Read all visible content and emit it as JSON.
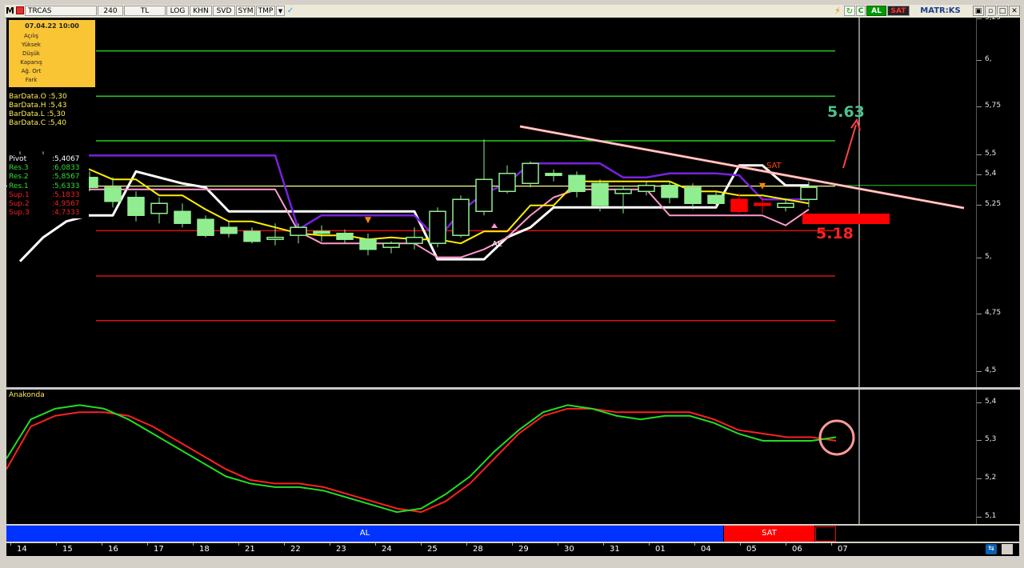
{
  "toolbar": {
    "m_label": "M",
    "symbol": "TRCAS",
    "period": "240",
    "currency": "TL",
    "buttons": [
      "LOG",
      "KHN",
      "SVD",
      "SYM",
      "TMP"
    ],
    "signal_al": "AL",
    "signal_sat": "SAT",
    "brand": "MATR:KS"
  },
  "info_box": {
    "date": "07.04.22 10:00",
    "fields": [
      "Açılış",
      "Yüksek",
      "Düşük",
      "Kapanış",
      "Ağ. Ort",
      "Fark"
    ]
  },
  "bar_data": [
    "BarData.O :5,30",
    "BarData.H :5,43",
    "BarData.L :5,30",
    "BarData.C :5,40"
  ],
  "pivot": {
    "rows": [
      {
        "key": "Pivot",
        "value": ":5,4067",
        "color": "#ffffff"
      },
      {
        "key": "Res.3",
        "value": ":6,0833",
        "color": "#33dd33"
      },
      {
        "key": "Res.2",
        "value": ":5,8567",
        "color": "#33dd33"
      },
      {
        "key": "Res.1",
        "value": ":5,6333",
        "color": "#33dd33"
      },
      {
        "key": "Sup.1",
        "value": ":5,1833",
        "color": "#ee2222"
      },
      {
        "key": "Sup.2",
        "value": ":4,9567",
        "color": "#ee2222"
      },
      {
        "key": "Sup.3",
        "value": ":4,7333",
        "color": "#ee2222"
      }
    ]
  },
  "annotations": {
    "target_high": "5.63",
    "target_low": "5.18",
    "al_label": "AL",
    "sat_label": "SAT"
  },
  "y_axis_main": [
    "5,25",
    "6,",
    "5,75",
    "5,5",
    "5,4",
    "5,25",
    "5,",
    "4,75",
    "4,5"
  ],
  "y_axis_sub": [
    "5,4",
    "5,3",
    "5,2",
    "5,1"
  ],
  "indicator_title": "Anakonda",
  "signal_bar": {
    "al": "AL",
    "sat": "SAT"
  },
  "dates": [
    "14",
    "15",
    "16",
    "17",
    "18",
    "21",
    "22",
    "23",
    "24",
    "25",
    "28",
    "29",
    "30",
    "31",
    "01",
    "04",
    "05",
    "06",
    "07"
  ],
  "colors": {
    "bull": "#90ee90",
    "bear": "#ff0000",
    "resistance": "#22cc22",
    "support": "#dd1111",
    "pivot": "#ffff88",
    "purple": "#7722dd",
    "white": "#ffffff",
    "yellow": "#ffee00",
    "pink": "#ff99cc",
    "al_bar": "#0033ff",
    "sat_bar": "#ff0000"
  },
  "chart_data": {
    "type": "candlestick",
    "ylim": [
      4.4,
      6.25
    ],
    "candles": [
      {
        "o": 5.5,
        "h": 5.58,
        "l": 5.48,
        "c": 5.55
      },
      {
        "o": 5.55,
        "h": 5.58,
        "l": 5.5,
        "c": 5.53
      },
      {
        "o": 5.48,
        "h": 5.52,
        "l": 5.4,
        "c": 5.45
      },
      {
        "o": 5.45,
        "h": 5.48,
        "l": 5.38,
        "c": 5.4
      },
      {
        "o": 5.4,
        "h": 5.45,
        "l": 5.3,
        "c": 5.33
      },
      {
        "o": 5.35,
        "h": 5.38,
        "l": 5.23,
        "c": 5.26
      },
      {
        "o": 5.27,
        "h": 5.35,
        "l": 5.22,
        "c": 5.32
      },
      {
        "o": 5.28,
        "h": 5.32,
        "l": 5.2,
        "c": 5.22
      },
      {
        "o": 5.24,
        "h": 5.26,
        "l": 5.15,
        "c": 5.16
      },
      {
        "o": 5.2,
        "h": 5.23,
        "l": 5.15,
        "c": 5.17
      },
      {
        "o": 5.18,
        "h": 5.2,
        "l": 5.12,
        "c": 5.13
      },
      {
        "o": 5.14,
        "h": 5.22,
        "l": 5.11,
        "c": 5.15
      },
      {
        "o": 5.16,
        "h": 5.22,
        "l": 5.12,
        "c": 5.2
      },
      {
        "o": 5.18,
        "h": 5.21,
        "l": 5.13,
        "c": 5.17
      },
      {
        "o": 5.17,
        "h": 5.19,
        "l": 5.12,
        "c": 5.14
      },
      {
        "o": 5.14,
        "h": 5.17,
        "l": 5.06,
        "c": 5.09
      },
      {
        "o": 5.1,
        "h": 5.13,
        "l": 5.07,
        "c": 5.12
      },
      {
        "o": 5.12,
        "h": 5.2,
        "l": 5.09,
        "c": 5.15
      },
      {
        "o": 5.12,
        "h": 5.3,
        "l": 5.1,
        "c": 5.28
      },
      {
        "o": 5.16,
        "h": 5.36,
        "l": 5.15,
        "c": 5.34
      },
      {
        "o": 5.28,
        "h": 5.64,
        "l": 5.26,
        "c": 5.44
      },
      {
        "o": 5.38,
        "h": 5.51,
        "l": 5.37,
        "c": 5.47
      },
      {
        "o": 5.42,
        "h": 5.53,
        "l": 5.4,
        "c": 5.52
      },
      {
        "o": 5.47,
        "h": 5.49,
        "l": 5.43,
        "c": 5.46
      },
      {
        "o": 5.46,
        "h": 5.48,
        "l": 5.35,
        "c": 5.38
      },
      {
        "o": 5.42,
        "h": 5.44,
        "l": 5.28,
        "c": 5.31
      },
      {
        "o": 5.37,
        "h": 5.41,
        "l": 5.27,
        "c": 5.39
      },
      {
        "o": 5.38,
        "h": 5.43,
        "l": 5.36,
        "c": 5.41
      },
      {
        "o": 5.41,
        "h": 5.43,
        "l": 5.32,
        "c": 5.35
      },
      {
        "o": 5.4,
        "h": 5.42,
        "l": 5.29,
        "c": 5.32
      },
      {
        "o": 5.36,
        "h": 5.38,
        "l": 5.3,
        "c": 5.32
      },
      {
        "o": 5.34,
        "h": 5.37,
        "l": 5.27,
        "c": 5.28
      },
      {
        "o": 5.32,
        "h": 5.35,
        "l": 5.27,
        "c": 5.31
      },
      {
        "o": 5.3,
        "h": 5.34,
        "l": 5.28,
        "c": 5.32
      },
      {
        "o": 5.34,
        "h": 5.43,
        "l": 5.3,
        "c": 5.4
      }
    ],
    "levels": {
      "res3": 6.0833,
      "res2": 5.8567,
      "res1": 5.6333,
      "pivot": 5.4067,
      "sup1": 5.1833,
      "sup2": 4.9567,
      "sup3": 4.7333,
      "hline": 5.41
    },
    "anakonda_ylim": [
      5.09,
      5.44
    ],
    "anakonda_green": [
      5.26,
      5.37,
      5.4,
      5.41,
      5.4,
      5.37,
      5.33,
      5.29,
      5.25,
      5.21,
      5.19,
      5.18,
      5.18,
      5.17,
      5.15,
      5.13,
      5.11,
      5.12,
      5.16,
      5.21,
      5.28,
      5.34,
      5.39,
      5.41,
      5.4,
      5.38,
      5.37,
      5.38,
      5.38,
      5.36,
      5.33,
      5.31,
      5.31,
      5.31,
      5.32
    ],
    "anakonda_red": [
      5.23,
      5.35,
      5.38,
      5.39,
      5.39,
      5.38,
      5.35,
      5.31,
      5.27,
      5.23,
      5.2,
      5.19,
      5.19,
      5.18,
      5.16,
      5.14,
      5.12,
      5.11,
      5.14,
      5.19,
      5.26,
      5.33,
      5.38,
      5.4,
      5.4,
      5.39,
      5.39,
      5.39,
      5.39,
      5.37,
      5.34,
      5.33,
      5.32,
      5.32,
      5.31
    ]
  }
}
